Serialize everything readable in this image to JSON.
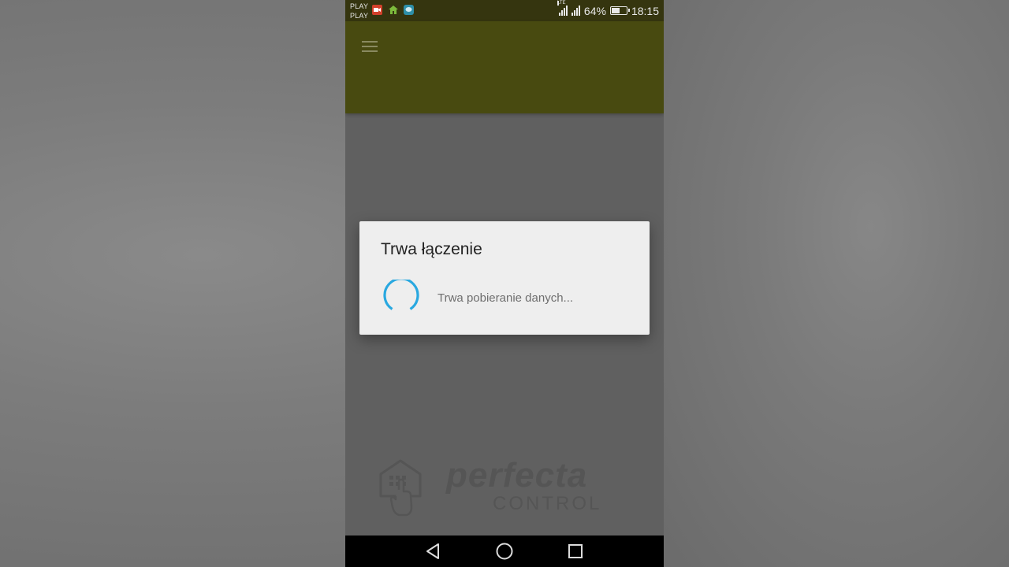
{
  "status_bar": {
    "carrier_line1": "PLAY",
    "carrier_line2": "PLAY",
    "network": "LTE",
    "battery": "64%",
    "battery_level": 0.64,
    "time": "18:15",
    "notification_icons": [
      "camera-notification-icon",
      "home-notification-icon",
      "chat-notification-icon"
    ]
  },
  "toolbar": {
    "menu_icon": "hamburger-menu-icon",
    "color": "#484a10"
  },
  "dialog": {
    "title": "Trwa łączenie",
    "message": "Trwa pobieranie danych...",
    "spinner_color": "#29a8e0"
  },
  "logo": {
    "name": "perfecta",
    "subtitle": "CONTROL",
    "icon": "house-keypad-touch-icon"
  },
  "nav_bar": {
    "buttons": [
      "back-icon",
      "home-icon",
      "recents-icon"
    ]
  }
}
